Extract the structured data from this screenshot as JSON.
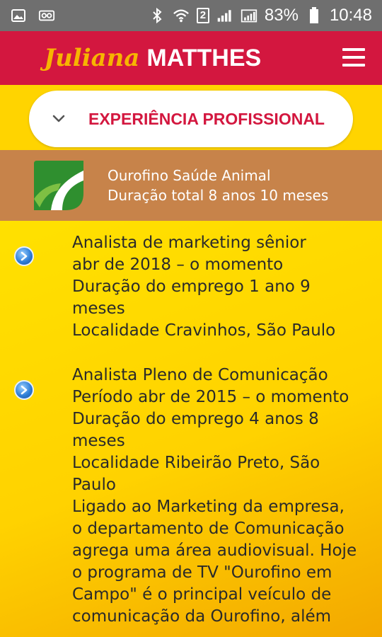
{
  "status_bar": {
    "battery": "83%",
    "time": "10:48",
    "sim": "2",
    "icons": [
      "image-icon",
      "voicemail-icon",
      "bluetooth-icon",
      "wifi-icon",
      "signal-icon",
      "battery-icon"
    ]
  },
  "header": {
    "logo_script": "Juliana",
    "logo_bold": "MATTHES",
    "menu_icon": "hamburger-icon"
  },
  "section": {
    "title": "EXPERIÊNCIA PROFISSIONAL",
    "icon": "chevron-down-icon"
  },
  "company": {
    "name": "Ourofino Saúde Animal",
    "duration": "Duração total 8 anos 10 meses"
  },
  "entries": [
    {
      "lines": [
        "Analista de marketing sênior",
        "abr de 2018 – o momento",
        "Duração do emprego 1 ano 9",
        "meses",
        "Localidade Cravinhos, São Paulo"
      ]
    },
    {
      "lines": [
        "Analista Pleno de Comunicação",
        "Período abr de 2015 – o momento",
        "Duração do emprego 4 anos 8",
        "meses",
        "Localidade Ribeirão Preto, São",
        "Paulo",
        "Ligado ao Marketing da empresa,",
        "o departamento de Comunicação",
        "agrega uma área audiovisual. Hoje",
        "o programa de TV \"Ourofino em",
        "Campo\" é o principal veículo de",
        "comunicação da Ourofino, além"
      ]
    }
  ],
  "colors": {
    "header": "#d3173f",
    "company_band": "#c7834a",
    "background": "#ffd400",
    "accent_logo": "#f7b500"
  }
}
